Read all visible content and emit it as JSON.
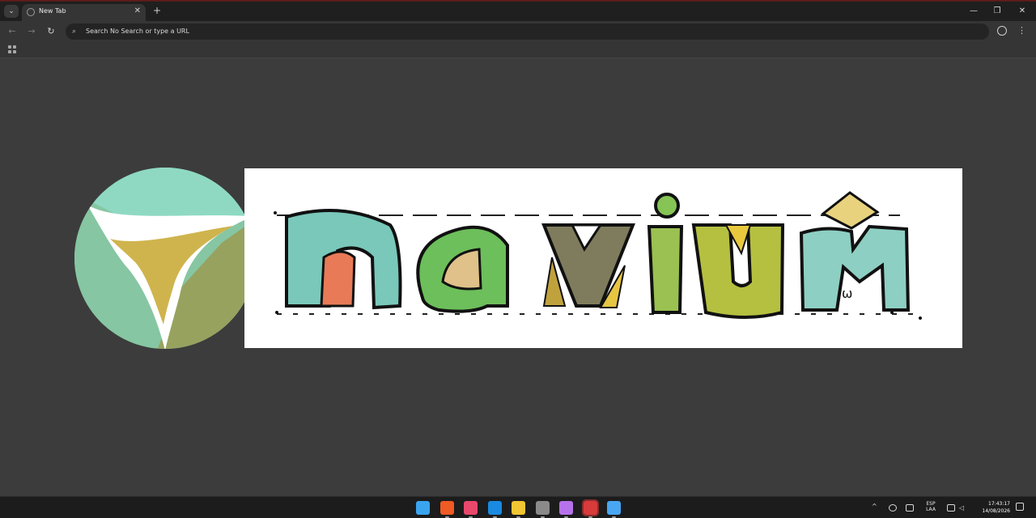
{
  "browser": {
    "tab_title": "New Tab",
    "omnibox_placeholder": "Search No Search or type a URL",
    "tab_search_icon": "chevron-down-icon",
    "close_symbol": "✕",
    "new_tab_symbol": "+",
    "minimize_symbol": "—",
    "maximize_symbol": "❐",
    "window_close_symbol": "✕",
    "back_symbol": "←",
    "forward_symbol": "→",
    "reload_symbol": "↻",
    "search_symbol": "⌕",
    "menu_symbol": "⋮"
  },
  "page": {
    "logo_alt": "Navium logo",
    "wordmark_text": "navium",
    "colors": {
      "circle_mint": "#8fd9c3",
      "circle_green": "#86c6a3",
      "circle_olive": "#97a25f",
      "inner_gold": "#cfb44e",
      "white": "#ffffff",
      "background": "#3c3c3c"
    }
  },
  "taskbar": {
    "apps": [
      {
        "name": "windows-start-icon",
        "color": "#3aa4ef"
      },
      {
        "name": "brave-icon",
        "color": "#f05a24"
      },
      {
        "name": "brave-beta-icon",
        "color": "#e8486c"
      },
      {
        "name": "vscode-icon",
        "color": "#1a8ae0"
      },
      {
        "name": "file-explorer-icon",
        "color": "#f2c532"
      },
      {
        "name": "settings-icon",
        "color": "#8a8a8a"
      },
      {
        "name": "gem-browser-icon",
        "color": "#b672ea"
      },
      {
        "name": "r-app-icon",
        "color": "#d83b3b"
      },
      {
        "name": "browser-icon",
        "color": "#49a6f3"
      }
    ],
    "lang_top": "ESP",
    "lang_bottom": "LAA",
    "time": "17:43:17",
    "date": "14/08/2026",
    "tray_chevron": "^"
  }
}
